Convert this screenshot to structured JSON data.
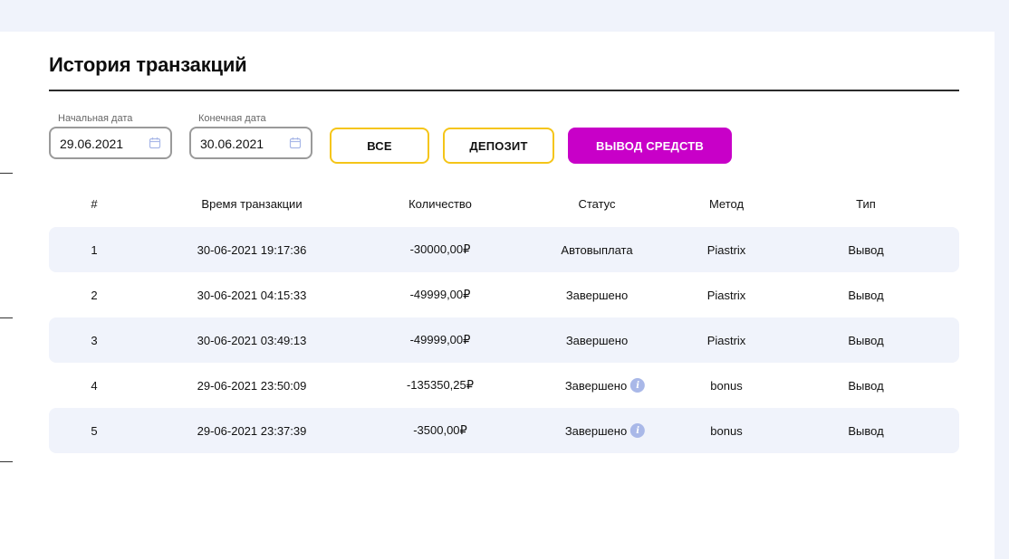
{
  "page": {
    "title": "История транзакций"
  },
  "filters": {
    "start_label": "Начальная дата",
    "start_value": "29.06.2021",
    "end_label": "Конечная дата",
    "end_value": "30.06.2021",
    "buttons": {
      "all": "ВСЕ",
      "deposit": "ДЕПОЗИТ",
      "withdraw": "ВЫВОД СРЕДСТВ"
    },
    "active_filter": "withdraw"
  },
  "colors": {
    "accent": "#c800c8",
    "outline": "#f5c518",
    "stripe": "#f0f3fb",
    "info_icon": "#a9b8e8"
  },
  "table": {
    "headers": {
      "num": "#",
      "time": "Время транзакции",
      "amount": "Количество",
      "status": "Статус",
      "method": "Метод",
      "type": "Тип"
    },
    "rows": [
      {
        "num": "1",
        "time": "30-06-2021 19:17:36",
        "amount": "-30000,00₽",
        "status": "Автовыплата",
        "method": "Piastrix",
        "type": "Вывод",
        "info": ""
      },
      {
        "num": "2",
        "time": "30-06-2021 04:15:33",
        "amount": "-49999,00₽",
        "status": "Завершено",
        "method": "Piastrix",
        "type": "Вывод",
        "info": ""
      },
      {
        "num": "3",
        "time": "30-06-2021 03:49:13",
        "amount": "-49999,00₽",
        "status": "Завершено",
        "method": "Piastrix",
        "type": "Вывод",
        "info": ""
      },
      {
        "num": "4",
        "time": "29-06-2021 23:50:09",
        "amount": "-135350,25₽",
        "status": "Завершено",
        "method": "bonus",
        "type": "Вывод",
        "info": "i"
      },
      {
        "num": "5",
        "time": "29-06-2021 23:37:39",
        "amount": "-3500,00₽",
        "status": "Завершено",
        "method": "bonus",
        "type": "Вывод",
        "info": "i"
      }
    ]
  }
}
